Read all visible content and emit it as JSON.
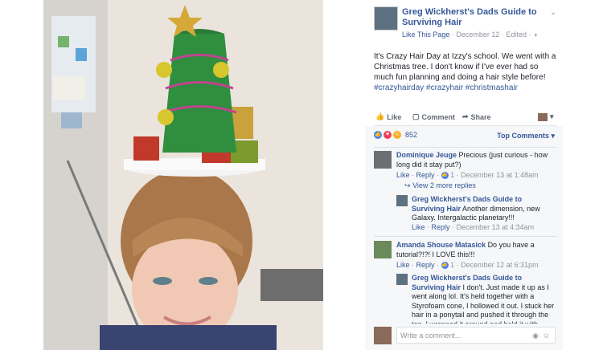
{
  "post": {
    "page_name": "Greg Wickherst's Dads Guide to Surviving Hair",
    "like_page": "Like This Page",
    "date": "December 12",
    "edited": "Edited",
    "text": "It's Crazy Hair Day at Izzy's school. We went with a Christmas tree. I don't know if I've ever had so much fun planning and doing a hair style before!",
    "hashtags": "#crazyhairday #crazyhair #christmashair"
  },
  "actions": {
    "like": "Like",
    "comment": "Comment",
    "share": "Share"
  },
  "reactions": {
    "count": "852",
    "top_comments": "Top Comments"
  },
  "comments": [
    {
      "name": "Dominique Jeuge",
      "text": "Precious (just curious - how long did it stay put?)",
      "like": "Like",
      "reply": "Reply",
      "likes": "1",
      "time": "December 13 at 1:48am",
      "more_replies": "View 2 more replies",
      "reply_item": {
        "name": "Greg Wickherst's Dads Guide to Surviving Hair",
        "text": "Another dimension, new Galaxy. Intergalactic planetary!!!",
        "like": "Like",
        "reply": "Reply",
        "time": "December 13 at 4:34am"
      }
    },
    {
      "name": "Amanda Shouse Matasick",
      "text": "Do you have a tutorial?!?! I LOVE this!!!",
      "like": "Like",
      "reply": "Reply",
      "likes": "1",
      "time": "December 12 at 6:31pm",
      "reply_item": {
        "name": "Greg Wickherst's Dads Guide to Surviving Hair",
        "text": "I don't. Just made it up as I went along lol. It's held together with a Styrofoam cone, I hollowed it out. I stuck her hair in a ponytail and pushed it through the top. I wrapped it around and held it with"
      }
    }
  ],
  "composer": {
    "placeholder": "Write a comment..."
  },
  "colors": {
    "link": "#365899",
    "muted": "#90949c",
    "panel_bg": "#f6f7f9"
  }
}
